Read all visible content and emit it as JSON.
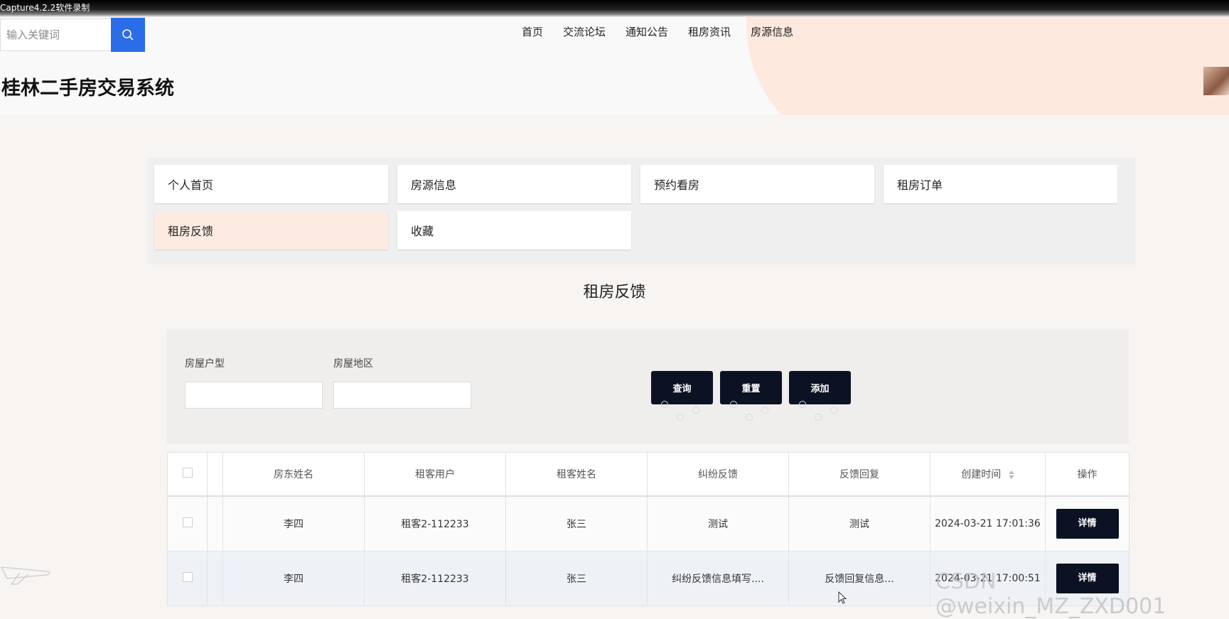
{
  "recorder_caption": "Capture4.2.2软件录制",
  "search": {
    "placeholder": "输入关键词"
  },
  "nav": [
    "首页",
    "交流论坛",
    "通知公告",
    "租房资讯",
    "房源信息"
  ],
  "site_title": "桂林二手房交易系统",
  "menu": [
    "个人首页",
    "房源信息",
    "预约看房",
    "租房订单",
    "租房反馈",
    "收藏"
  ],
  "active_menu": "租房反馈",
  "page_heading": "租房反馈",
  "filter": {
    "field1_label": "房屋户型",
    "field2_label": "房屋地区",
    "query_label": "查询",
    "reset_label": "重置",
    "add_label": "添加"
  },
  "table": {
    "headers": [
      "房东姓名",
      "租客用户",
      "租客姓名",
      "纠纷反馈",
      "反馈回复",
      "创建时间",
      "操作"
    ],
    "rows": [
      [
        "李四",
        "租客2-112233",
        "张三",
        "测试",
        "测试",
        "2024-03-21 17:01:36"
      ],
      [
        "李四",
        "租客2-112233",
        "张三",
        "纠纷反馈信息填写....",
        "反馈回复信息...",
        "2024-03-21 17:00:51"
      ]
    ],
    "detail_label": "详情"
  },
  "watermark": "CSDN @weixin_MZ_ZXD001",
  "colors": {
    "search_button": "#2b6de8",
    "dark_button": "#0b1223",
    "active_menu_bg": "#fdeae0"
  }
}
